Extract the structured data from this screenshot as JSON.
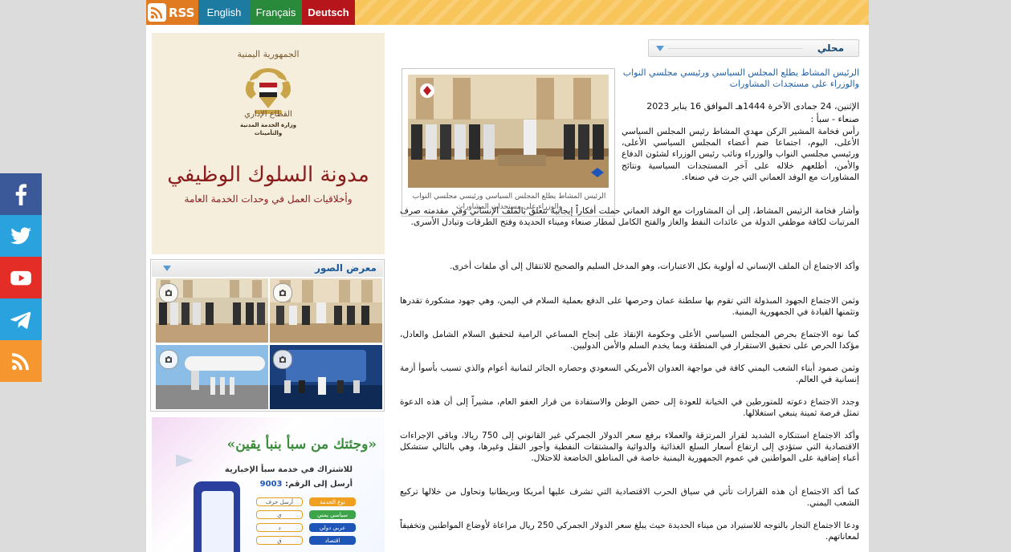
{
  "topbar": {
    "rss_label": "RSS",
    "languages": [
      {
        "label": "English",
        "color": "#1d7aa1"
      },
      {
        "label": "Français",
        "color": "#2a8a3c"
      },
      {
        "label": "Deutsch",
        "color": "#b5151b"
      }
    ]
  },
  "banner_top": {
    "top_text": "الجمهورية اليمنية",
    "line1": "القطاع الإداري",
    "line2a": "وزارة الخدمة المدنية",
    "line2b": "والتأمينات",
    "title": "مدونة السلوك الوظيفي",
    "subtitle": "وأخلاقيات العمل في وحدات الخدمة العامة"
  },
  "gallery": {
    "title": "معرض الصور"
  },
  "banner_bottom": {
    "headline": "«وجئتك من سبأ بنبأ يقين»",
    "line1": "للاشتراك في خدمة سبأ الإخبارية",
    "line2_prefix": "أرسل إلى الرقم:",
    "number": "9003",
    "table": [
      [
        "أرسل حرف",
        "نوع الخدمة"
      ],
      [
        "ي",
        "سياسي يمني"
      ],
      [
        "د",
        "عربي دولي"
      ],
      [
        "ق",
        "اقتصاد"
      ]
    ]
  },
  "section": {
    "title": "محلي"
  },
  "article": {
    "headline": "الرئيس المشاط يطلع المجلس السياسي ورئيسي مجلسي النواب والوزراء على مستجدات المشاورات",
    "date": "الإثنين، 24 جمادى الآخرة 1444هـ الموافق 16 يناير 2023",
    "dateline": "صنعاء - سبأ :",
    "photo_caption": "الرئيس المشاط يطلع المجلس السياسي ورئيسي مجلسي النواب والوزراء على مستجدات المشاورات",
    "paragraphs": [
      "رأس فخامة المشير الركن مهدي المشاط رئيس المجلس السياسي الأعلى، اليوم، اجتماعا ضم أعضاء المجلس السياسي الأعلى، ورئيسي مجلسي النواب والوزراء ونائب رئيس الوزراء لشئون الدفاع والأمن، أطلعهم خلاله على آخر المستجدات السياسية ونتائج المشاورات مع الوفد العماني التي جرت في صنعاء.",
      "وأشار فخامة الرئيس المشاط، إلى أن المشاورات مع الوفد العماني حملت أفكاراً إيجابية تتعلق بالملف الإنساني وفي مقدمته صرف المرتبات لكافة موظفي الدولة من عائدات النفط والغاز والفتح الكامل لمطار صنعاء وميناء الحديدة وفتح الطرقات وتبادل الأسرى.",
      "وأكد الاجتماع أن الملف الإنساني له أولوية بكل الاعتبارات، وهو المدخل السليم والصحيح للانتقال إلى أي ملفات أخرى.",
      "وثمن الاجتماع الجهود المبذولة التي تقوم بها سلطنة عمان وحرصها على الدفع بعملية السلام في اليمن، وهي جهود مشكورة تقدرها وتثمنها القيادة في الجمهورية اليمنية.",
      "كما نوه الاجتماع بحرص المجلس السياسي الأعلى وحكومة الإنقاذ على إنجاح المساعي الرامية لتحقيق السلام الشامل والعادل، مؤكدا الحرص على تحقيق الاستقرار في المنطقة وبما يخدم السلم والأمن الدوليين.",
      "وثمن صمود أبناء الشعب اليمني كافة في مواجهة العدوان الأمريكي السعودي وحصاره الجائر لثمانية أعوام والذي تسبب بأسوأ أزمة إنسانية في العالم.",
      "وجدد الاجتماع دعوته للمتورطين في الخيانة للعودة إلى حضن الوطن والاستفادة من قرار العفو العام، مشيراً إلى أن هذه الدعوة تمثل فرصة ثمينة ينبغي استغلالها.",
      "وأكد الاجتماع استنكاره الشديد لقرار المرتزقة والعملاء برفع سعر الدولار الجمركي غير القانوني إلى 750 ريالا، وباقي الإجراءات الاقتصادية التي ستؤدي إلى ارتفاع أسعار السلع الغذائية والدوائية والمشتقات النفطية وأجور النقل وغيرها، وهي بالتالي ستشكل أعباء إضافية على المواطنين في عموم الجمهورية اليمنية خاصة في المناطق الخاضعة للاحتلال.",
      "كما أكد الاجتماع أن هذه القرارات تأتي في سياق الحرب الاقتصادية التي تشرف عليها أمريكا وبريطانيا وتحاول من خلالها تركيع الشعب اليمني.",
      "ودعا الاجتماع التجار بالتوجه للاستيراد من ميناء الحديدة حيث يبلغ سعر الدولار الجمركي 250 ريال مراعاة لأوضاع المواطنين وتخفيفاً لمعاناتهم."
    ]
  },
  "social": [
    {
      "icon": "facebook-icon",
      "color": "#3b5998"
    },
    {
      "icon": "twitter-icon",
      "color": "#2aa2de"
    },
    {
      "icon": "youtube-icon",
      "color": "#e52d27"
    },
    {
      "icon": "telegram-icon",
      "color": "#2aa2de"
    },
    {
      "icon": "rss-feed-icon",
      "color": "#f5962e"
    }
  ]
}
